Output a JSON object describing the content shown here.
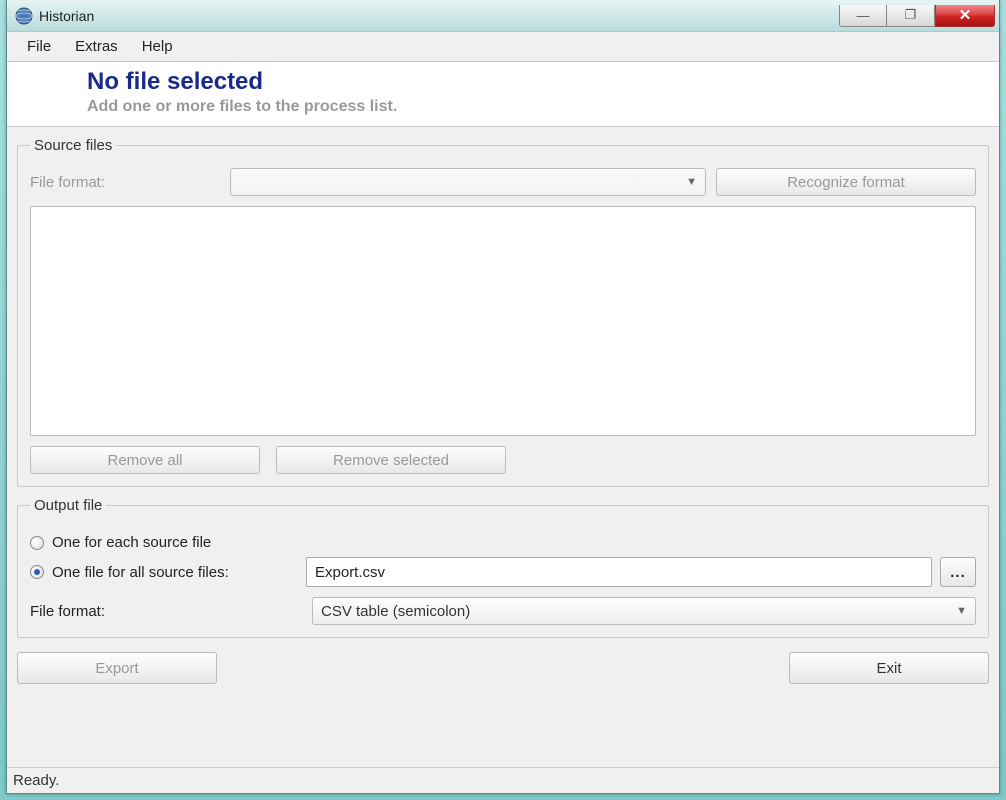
{
  "window": {
    "title": "Historian"
  },
  "menu": {
    "file": "File",
    "extras": "Extras",
    "help": "Help"
  },
  "header": {
    "heading": "No file selected",
    "subheading": "Add one or more files to the process list."
  },
  "source": {
    "legend": "Source files",
    "file_format_label": "File format:",
    "file_format_value": "",
    "recognize_button": "Recognize format",
    "remove_all": "Remove all",
    "remove_selected": "Remove selected"
  },
  "output": {
    "legend": "Output file",
    "radio_each": "One for each source file",
    "radio_all": "One file for all source files:",
    "filename": "Export.csv",
    "browse": "...",
    "file_format_label": "File format:",
    "file_format_value": "CSV table (semicolon)"
  },
  "actions": {
    "export": "Export",
    "exit": "Exit"
  },
  "status": {
    "text": "Ready."
  },
  "win_controls": {
    "min": "—",
    "max": "❐",
    "close": "✕"
  }
}
